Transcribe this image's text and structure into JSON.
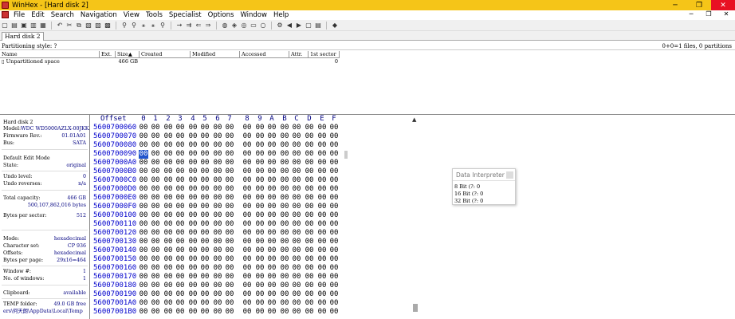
{
  "window": {
    "title": "WinHex - [Hard disk 2]",
    "min": "─",
    "max": "❐",
    "close": "✕"
  },
  "menu": [
    "File",
    "Edit",
    "Search",
    "Navigation",
    "View",
    "Tools",
    "Specialist",
    "Options",
    "Window",
    "Help"
  ],
  "doc_tab": "Hard disk 2",
  "partition_style": "Partitioning style: ?",
  "files_summary": "0+0=1 files, 0 partitions",
  "file_table": {
    "columns": [
      "Name",
      "Ext.",
      "Size",
      "Created",
      "Modified",
      "Accessed",
      "Attr.",
      "1st sector"
    ],
    "sort_indicator": "▲",
    "rows": [
      {
        "name": "Unpartitioned space",
        "ext": "",
        "size": "466 GB",
        "created": "",
        "modified": "",
        "accessed": "",
        "attr": "",
        "first_sector": "0"
      }
    ]
  },
  "info": {
    "disk_name": "Hard disk 2",
    "model_label": "Model:",
    "model_value": "WDC WD5000AZLX-00JKKA0",
    "firmware_label": "Firmware Rev.:",
    "firmware_value": "01.01A01",
    "bus_label": "Bus:",
    "bus_value": "SATA",
    "edit_mode_label": "Default Edit Mode",
    "state_label": "State:",
    "state_value": "original",
    "undo_level_label": "Undo level:",
    "undo_level_value": "0",
    "undo_rev_label": "Undo reverses:",
    "undo_rev_value": "n/a",
    "capacity_label": "Total capacity:",
    "capacity_value": "466 GB",
    "capacity_bytes": "500,107,862,016 bytes",
    "bps_label": "Bytes per sector:",
    "bps_value": "512",
    "mode_label": "Mode:",
    "mode_value": "hexadecimal",
    "charset_label": "Character set:",
    "charset_value": "CP 936",
    "offsets_label": "Offsets:",
    "offsets_value": "hexadecimal",
    "bpp_label": "Bytes per page:",
    "bpp_value": "29x16=464",
    "window_no_label": "Window #:",
    "window_no_value": "1",
    "windows_count_label": "No. of windows:",
    "windows_count_value": "1",
    "clipboard_label": "Clipboard:",
    "clipboard_value": "available",
    "temp_label": "TEMP folder:",
    "temp_value": "49.0 GB free",
    "temp_path": "ers\\何天朗\\AppData\\Local\\Temp"
  },
  "hex": {
    "offset_label": "Offset",
    "columns": [
      "0",
      "1",
      "2",
      "3",
      "4",
      "5",
      "6",
      "7",
      "8",
      "9",
      "A",
      "B",
      "C",
      "D",
      "E",
      "F"
    ],
    "rows": [
      "5600700060",
      "5600700070",
      "5600700080",
      "5600700090",
      "56007000A0",
      "56007000B0",
      "56007000C0",
      "56007000D0",
      "56007000E0",
      "56007000F0",
      "5600700100",
      "5600700110",
      "5600700120",
      "5600700130",
      "5600700140",
      "5600700150",
      "5600700160",
      "5600700170",
      "5600700180",
      "5600700190",
      "56007001A0",
      "56007001B0"
    ],
    "byte_value": "00"
  },
  "interpreter": {
    "title": "Data Interpreter",
    "lines": [
      "8 Bit (?: 0",
      "16 Bit (?: 0",
      "32 Bit (?: 0"
    ]
  }
}
